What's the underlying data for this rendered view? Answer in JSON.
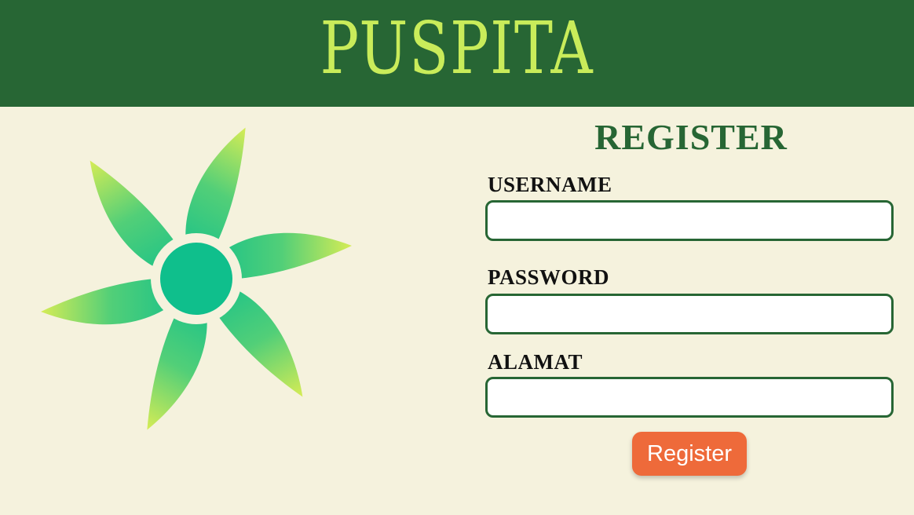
{
  "header": {
    "brand": "PUSPITA"
  },
  "logo": {
    "icon": "flower-logo-icon"
  },
  "form": {
    "title": "REGISTER",
    "username_label": "USERNAME",
    "username_value": "",
    "password_label": "PASSWORD",
    "password_value": "",
    "alamat_label": "ALAMAT",
    "alamat_value": "",
    "submit_label": "Register"
  },
  "colors": {
    "header_bg": "#276634",
    "brand_text": "#c9ec5a",
    "page_bg": "#f5f2dd",
    "title_text": "#276634",
    "input_border": "#276634",
    "button_bg": "#ee6a3a",
    "logo_gradient_start": "#0fbf8c",
    "logo_gradient_end": "#d6ec55"
  }
}
